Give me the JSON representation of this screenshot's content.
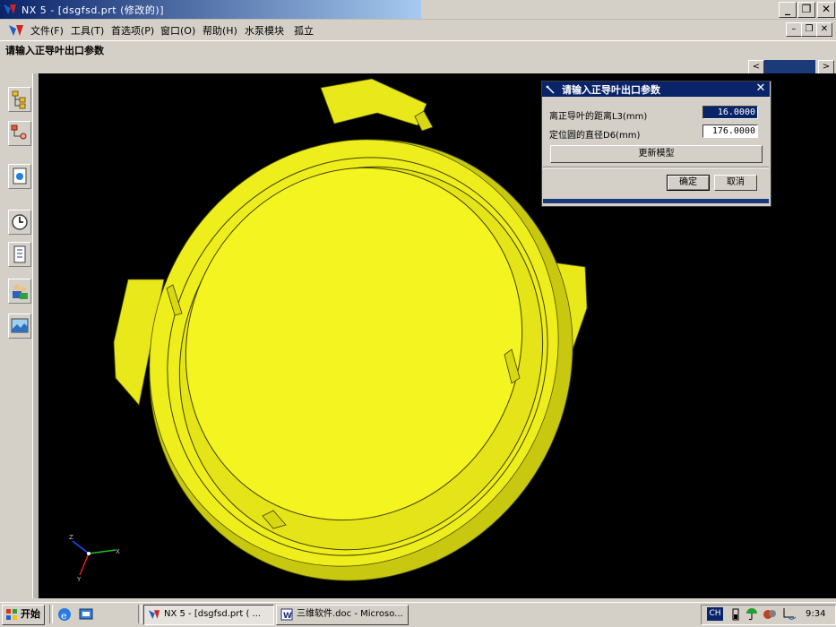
{
  "window": {
    "title": "NX 5 - [dsgfsd.prt (修改的)]",
    "controls": {
      "minimize": "_",
      "restore": "❐",
      "close": "✕"
    }
  },
  "menubar": {
    "items": [
      "文件(F)",
      "工具(T)",
      "首选项(P)",
      "窗口(O)",
      "帮助(H)",
      "水泵模块",
      "孤立"
    ],
    "mdi": {
      "minimize": "–",
      "restore": "❐",
      "close": "✕"
    }
  },
  "cue_line": "请输入正导叶出口参数",
  "scrollbar": {
    "left": "<",
    "right": ">"
  },
  "left_resource_bar": {
    "icons": [
      "assembly-navigator-icon",
      "part-navigator-icon",
      "web-browser-icon",
      "history-icon",
      "reuse-library-icon",
      "roles-icon",
      "system-visualization-icon"
    ]
  },
  "dialog": {
    "title": "请输入正导叶出口参数",
    "close": "✕",
    "fields": [
      {
        "label": "离正导叶的距离L3(mm)",
        "value": "16.0000"
      },
      {
        "label": "定位圆的直径D6(mm)",
        "value": "176.0000"
      }
    ],
    "update_button": "更新模型",
    "ok_button": "确定",
    "cancel_button": "取消"
  },
  "triad": {
    "x": "X",
    "y": "Y",
    "z": "Z"
  },
  "taskbar": {
    "start": "开始",
    "tasks": [
      {
        "label": "NX 5 - [dsgfsd.prt ( ..."
      },
      {
        "label": "三维软件.doc - Microso..."
      }
    ],
    "ime": "CH",
    "clock": "9:34"
  },
  "colors": {
    "model": "#f0f020",
    "viewport_bg": "#000000",
    "title_active": "#0a246a"
  }
}
